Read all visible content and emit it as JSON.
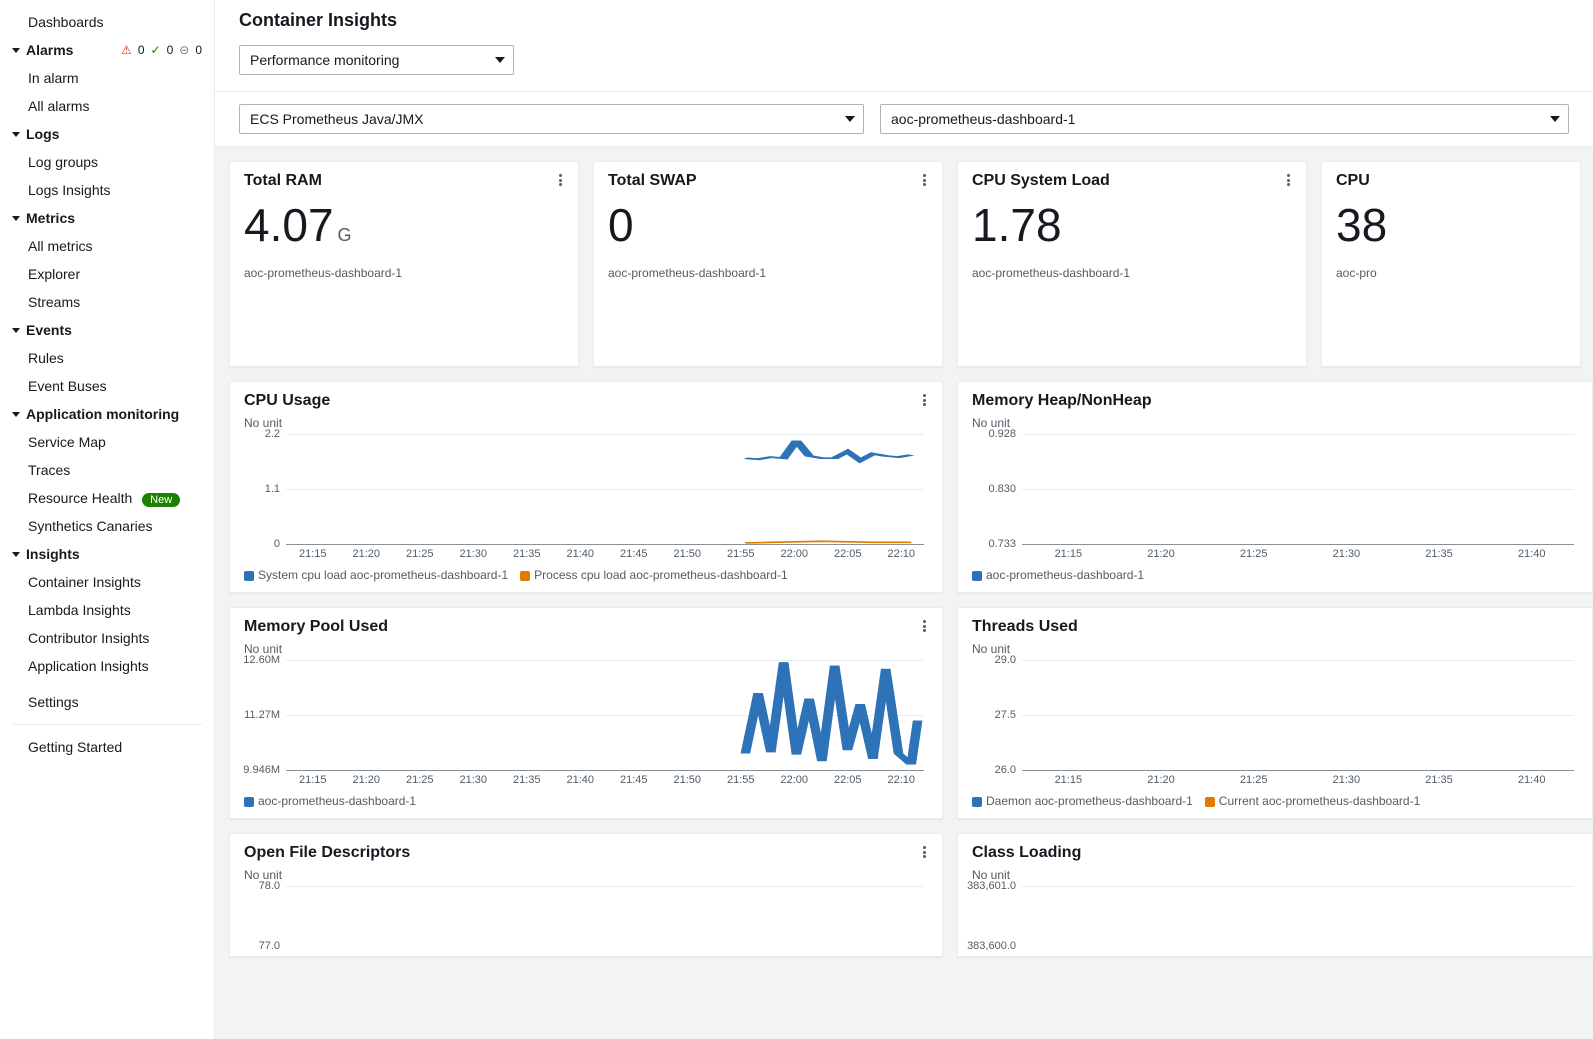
{
  "sidebar": {
    "dashboards": "Dashboards",
    "alarms": {
      "label": "Alarms",
      "status_alert": "0",
      "status_ok": "0",
      "status_insufficient": "0",
      "in_alarm": "In alarm",
      "all_alarms": "All alarms"
    },
    "logs": {
      "label": "Logs",
      "log_groups": "Log groups",
      "logs_insights": "Logs Insights"
    },
    "metrics": {
      "label": "Metrics",
      "all_metrics": "All metrics",
      "explorer": "Explorer",
      "streams": "Streams"
    },
    "events": {
      "label": "Events",
      "rules": "Rules",
      "event_buses": "Event Buses"
    },
    "app_monitoring": {
      "label": "Application monitoring",
      "service_map": "Service Map",
      "traces": "Traces",
      "resource_health": "Resource Health",
      "resource_health_badge": "New",
      "synthetics": "Synthetics Canaries"
    },
    "insights": {
      "label": "Insights",
      "container": "Container Insights",
      "lambda": "Lambda Insights",
      "contributor": "Contributor Insights",
      "application": "Application Insights"
    },
    "settings": "Settings",
    "getting_started": "Getting Started"
  },
  "header": {
    "title": "Container Insights",
    "view_selector": "Performance monitoring"
  },
  "filters": {
    "metric_type": "ECS Prometheus Java/JMX",
    "resource": "aoc-prometheus-dashboard-1"
  },
  "metric_cards": [
    {
      "title": "Total RAM",
      "value": "4.07",
      "unit": "G",
      "sub": "aoc-prometheus-dashboard-1"
    },
    {
      "title": "Total SWAP",
      "value": "0",
      "unit": "",
      "sub": "aoc-prometheus-dashboard-1"
    },
    {
      "title": "CPU System Load",
      "value": "1.78",
      "unit": "",
      "sub": "aoc-prometheus-dashboard-1"
    },
    {
      "title": "CPU",
      "value": "38",
      "unit": "",
      "sub": "aoc-pro"
    }
  ],
  "x_ticks": [
    "21:15",
    "21:20",
    "21:25",
    "21:30",
    "21:35",
    "21:40",
    "21:45",
    "21:50",
    "21:55",
    "22:00",
    "22:05",
    "22:10"
  ],
  "x_ticks_short": [
    "21:15",
    "21:20",
    "21:25",
    "21:30",
    "21:35",
    "21:40"
  ],
  "charts": {
    "cpu_usage": {
      "title": "CPU Usage",
      "unit_label": "No unit",
      "y_ticks": [
        "2.2",
        "1.1",
        "0"
      ],
      "legend": [
        {
          "color": "#2e73b8",
          "label": "System cpu load aoc-prometheus-dashboard-1"
        },
        {
          "color": "#e07b00",
          "label": "Process cpu load aoc-prometheus-dashboard-1"
        }
      ]
    },
    "memory_heap": {
      "title": "Memory Heap/NonHeap",
      "unit_label": "No unit",
      "y_ticks": [
        "0.928",
        "0.830",
        "0.733"
      ],
      "legend": [
        {
          "color": "#2e73b8",
          "label": "aoc-prometheus-dashboard-1"
        }
      ]
    },
    "memory_pool": {
      "title": "Memory Pool Used",
      "unit_label": "No unit",
      "y_ticks": [
        "12.60M",
        "11.27M",
        "9.946M"
      ],
      "legend": [
        {
          "color": "#2e73b8",
          "label": "aoc-prometheus-dashboard-1"
        }
      ]
    },
    "threads": {
      "title": "Threads Used",
      "unit_label": "No unit",
      "y_ticks": [
        "29.0",
        "27.5",
        "26.0"
      ],
      "legend": [
        {
          "color": "#2e73b8",
          "label": "Daemon aoc-prometheus-dashboard-1"
        },
        {
          "color": "#e07b00",
          "label": "Current aoc-prometheus-dashboard-1"
        }
      ]
    },
    "open_fd": {
      "title": "Open File Descriptors",
      "unit_label": "No unit",
      "y_ticks": [
        "78.0",
        "77.0"
      ]
    },
    "class_loading": {
      "title": "Class Loading",
      "unit_label": "No unit",
      "y_ticks": [
        "383,601.0",
        "383,600.0"
      ]
    }
  },
  "chart_data": [
    {
      "id": "cpu_usage",
      "type": "line",
      "title": "CPU Usage",
      "xlabel": "",
      "ylabel": "",
      "ylim": [
        0,
        2.2
      ],
      "unit": "No unit",
      "x": [
        "21:15",
        "21:20",
        "21:25",
        "21:30",
        "21:35",
        "21:40",
        "21:45",
        "21:50",
        "21:55",
        "22:00",
        "22:05",
        "22:10"
      ],
      "series": [
        {
          "name": "System cpu load aoc-prometheus-dashboard-1",
          "color": "#2e73b8",
          "values": [
            null,
            null,
            null,
            null,
            null,
            null,
            null,
            1.75,
            1.72,
            1.78,
            1.74,
            2.15,
            1.8,
            1.76,
            1.74,
            1.9,
            1.7,
            1.85,
            1.8,
            1.78,
            1.76,
            1.8
          ],
          "x_fine": [
            "21:50",
            "21:51",
            "21:52",
            "21:53",
            "21:54",
            "21:55",
            "21:56",
            "21:57",
            "21:58",
            "21:59",
            "22:00",
            "22:01",
            "22:02",
            "22:03",
            "22:04",
            "22:05",
            "22:06",
            "22:07",
            "22:08",
            "22:09",
            "22:10",
            "22:11"
          ]
        },
        {
          "name": "Process cpu load aoc-prometheus-dashboard-1",
          "color": "#e07b00",
          "values": [
            null,
            null,
            null,
            null,
            null,
            null,
            null,
            0.04,
            0.05,
            0.05,
            0.05,
            0.06,
            0.07,
            0.06,
            0.05,
            0.05,
            0.05,
            0.05,
            0.04,
            0.04,
            0.05,
            0.05
          ],
          "x_fine": [
            "21:50",
            "21:51",
            "21:52",
            "21:53",
            "21:54",
            "21:55",
            "21:56",
            "21:57",
            "21:58",
            "21:59",
            "22:00",
            "22:01",
            "22:02",
            "22:03",
            "22:04",
            "22:05",
            "22:06",
            "22:07",
            "22:08",
            "22:09",
            "22:10",
            "22:11"
          ]
        }
      ]
    },
    {
      "id": "memory_heap",
      "type": "line",
      "title": "Memory Heap/NonHeap",
      "ylim": [
        0.733,
        0.928
      ],
      "unit": "No unit",
      "x": [
        "21:15",
        "21:20",
        "21:25",
        "21:30",
        "21:35",
        "21:40"
      ],
      "series": [
        {
          "name": "aoc-prometheus-dashboard-1",
          "color": "#2e73b8",
          "values": [
            null,
            null,
            null,
            null,
            null,
            null
          ]
        }
      ]
    },
    {
      "id": "memory_pool",
      "type": "line",
      "title": "Memory Pool Used",
      "ylim": [
        9.946,
        12.6
      ],
      "unit": "No unit (M)",
      "x": [
        "21:15",
        "21:20",
        "21:25",
        "21:30",
        "21:35",
        "21:40",
        "21:45",
        "21:50",
        "21:55",
        "22:00",
        "22:05",
        "22:10"
      ],
      "series": [
        {
          "name": "aoc-prometheus-dashboard-1",
          "color": "#2e73b8",
          "values": [
            null,
            null,
            null,
            null,
            null,
            null,
            null,
            10.2,
            12.0,
            10.3,
            12.6,
            10.2,
            11.8,
            10.0,
            12.5,
            10.3,
            11.6,
            10.1,
            12.4,
            10.2,
            10.0,
            11.2
          ],
          "x_fine": [
            "21:50",
            "21:51",
            "21:52",
            "21:53",
            "21:54",
            "21:55",
            "21:56",
            "21:57",
            "21:58",
            "21:59",
            "22:00",
            "22:01",
            "22:02",
            "22:03",
            "22:04",
            "22:05",
            "22:06",
            "22:07",
            "22:08",
            "22:09",
            "22:10",
            "22:11"
          ]
        }
      ]
    },
    {
      "id": "threads",
      "type": "line",
      "title": "Threads Used",
      "ylim": [
        26.0,
        29.0
      ],
      "unit": "No unit",
      "x": [
        "21:15",
        "21:20",
        "21:25",
        "21:30",
        "21:35",
        "21:40"
      ],
      "series": [
        {
          "name": "Daemon aoc-prometheus-dashboard-1",
          "color": "#2e73b8",
          "values": [
            null,
            null,
            null,
            null,
            null,
            null
          ]
        },
        {
          "name": "Current aoc-prometheus-dashboard-1",
          "color": "#e07b00",
          "values": [
            null,
            null,
            null,
            null,
            null,
            null
          ]
        }
      ]
    },
    {
      "id": "open_fd",
      "type": "line",
      "title": "Open File Descriptors",
      "ylim": [
        77.0,
        78.0
      ],
      "unit": "No unit",
      "x": [
        "21:15",
        "21:20",
        "21:25",
        "21:30",
        "21:35",
        "21:40",
        "21:45",
        "21:50",
        "21:55",
        "22:00",
        "22:05",
        "22:10"
      ],
      "series": []
    },
    {
      "id": "class_loading",
      "type": "line",
      "title": "Class Loading",
      "ylim": [
        383600.0,
        383601.0
      ],
      "unit": "No unit",
      "x": [
        "21:15",
        "21:20",
        "21:25",
        "21:30",
        "21:35",
        "21:40"
      ],
      "series": []
    }
  ]
}
